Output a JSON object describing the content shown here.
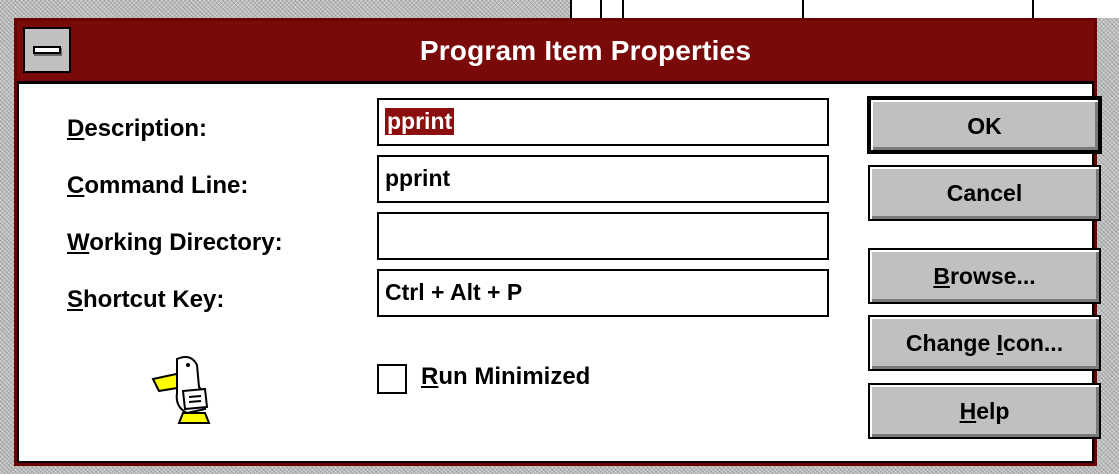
{
  "window": {
    "title": "Program Item Properties"
  },
  "labels": {
    "description": {
      "first": "D",
      "rest": "escription:"
    },
    "command_line": {
      "first": "C",
      "rest": "ommand Line:"
    },
    "working_directory": {
      "first": "W",
      "rest": "orking Directory:"
    },
    "shortcut_key": {
      "first": "S",
      "rest": "hortcut Key:"
    }
  },
  "fields": {
    "description_value": "pprint",
    "command_line_value": "pprint",
    "working_directory_value": "",
    "shortcut_key_value": "Ctrl + Alt + P"
  },
  "checkbox": {
    "run_minimized": {
      "first": "R",
      "rest": "un Minimized",
      "checked": false
    }
  },
  "buttons": {
    "ok": "OK",
    "cancel": "Cancel",
    "browse": {
      "first": "B",
      "rest": "rowse..."
    },
    "change_icon": {
      "before": "Change ",
      "first": "I",
      "rest": "con..."
    },
    "help": {
      "first": "H",
      "rest": "elp"
    }
  },
  "icon": {
    "name": "pelican-program-icon"
  },
  "colors": {
    "titlebar": "#7a0a0a",
    "selection": "#8b0f0f",
    "button_face": "#c0c0c0"
  }
}
